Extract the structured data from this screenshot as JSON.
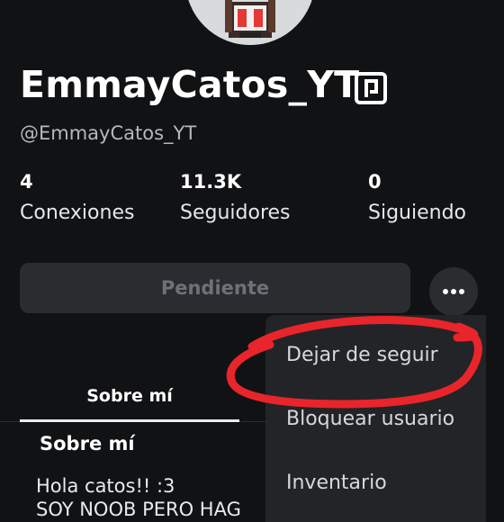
{
  "profile": {
    "display_name": "EmmayCatos_YT",
    "username": "@EmmayCatos_YT"
  },
  "stats": {
    "connections": {
      "value": "4",
      "label": "Conexiones"
    },
    "followers": {
      "value": "11.3K",
      "label": "Seguidores"
    },
    "following": {
      "value": "0",
      "label": "Siguiendo"
    }
  },
  "actions": {
    "pending_label": "Pendiente",
    "more_icon": "ellipsis-icon"
  },
  "tabs": {
    "about_label": "Sobre mí"
  },
  "about": {
    "title": "Sobre mí",
    "bio_line1": "Hola catos!! :3",
    "bio_line2": "SOY NOOB PERO HAG"
  },
  "menu": {
    "items": [
      "Dejar de seguir",
      "Bloquear usuario",
      "Inventario"
    ]
  },
  "colors": {
    "background": "#111214",
    "button_bg": "#2a2c30",
    "menu_bg": "#232428",
    "annotation_red": "#e8252b"
  }
}
